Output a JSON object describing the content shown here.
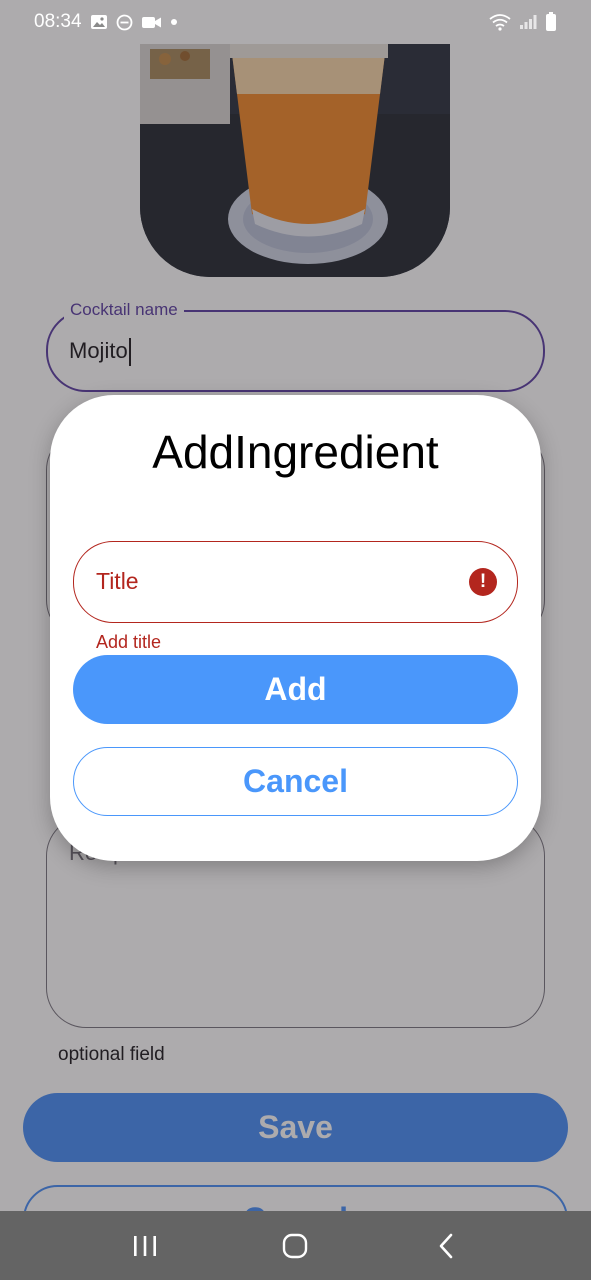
{
  "status_bar": {
    "time": "08:34",
    "icons": [
      "image-icon",
      "dnd-icon",
      "video-icon",
      "dot-icon",
      "wifi-icon",
      "signal-icon",
      "battery-icon"
    ]
  },
  "form": {
    "cocktail_name_label": "Cocktail name",
    "cocktail_name_value": "Mojito",
    "recipe_placeholder": "Recipe",
    "recipe_helper": "optional field",
    "save_label": "Save",
    "cancel_label": "Cancel"
  },
  "dialog": {
    "title": "AddIngredient",
    "title_field_placeholder": "Title",
    "error_text": "Add title",
    "add_label": "Add",
    "cancel_label": "Cancel"
  },
  "nav_bar": {
    "items": [
      "recents-icon",
      "home-icon",
      "back-icon"
    ]
  },
  "colors": {
    "primary": "#4a97fb",
    "outline_focused": "#5c3fa3",
    "error": "#b3261e",
    "scrim": "#282228"
  }
}
